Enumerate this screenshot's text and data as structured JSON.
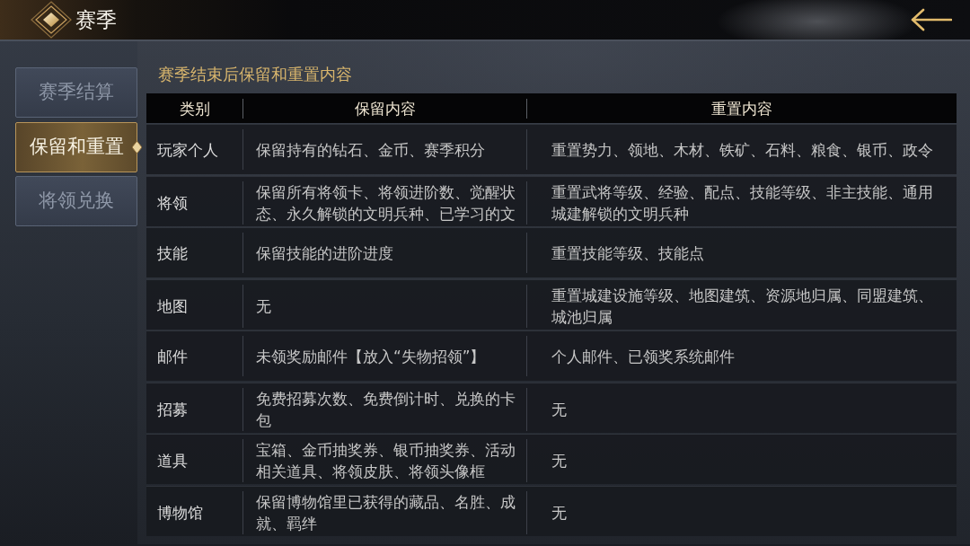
{
  "header": {
    "title": "赛季"
  },
  "sidebar": {
    "tabs": [
      {
        "label": "赛季结算",
        "selected": false
      },
      {
        "label": "保留和重置",
        "selected": true
      },
      {
        "label": "将领兑换",
        "selected": false
      }
    ]
  },
  "panel": {
    "title": "赛季结束后保留和重置内容",
    "table": {
      "columns": [
        "类别",
        "保留内容",
        "重置内容"
      ],
      "rows": [
        [
          "玩家个人",
          "保留持有的钻石、金币、赛季积分",
          "重置势力、领地、木材、铁矿、石料、粮食、银币、政令"
        ],
        [
          "将领",
          "保留所有将领卡、将领进阶数、觉醒状态、永久解锁的文明兵种、已学习的文",
          "重置武将等级、经验、配点、技能等级、非主技能、通用城建解锁的文明兵种"
        ],
        [
          "技能",
          "保留技能的进阶进度",
          "重置技能等级、技能点"
        ],
        [
          "地图",
          "无",
          "重置城建设施等级、地图建筑、资源地归属、同盟建筑、城池归属"
        ],
        [
          "邮件",
          "未领奖励邮件【放入“失物招领”】",
          "个人邮件、已领奖系统邮件"
        ],
        [
          "招募",
          "免费招募次数、免费倒计时、兑换的卡包",
          "无"
        ],
        [
          "道具",
          "宝箱、金币抽奖券、银币抽奖券、活动相关道具、将领皮肤、将领头像框",
          "无"
        ],
        [
          "博物馆",
          "保留博物馆里已获得的藏品、名胜、成就、羁绊",
          "无"
        ]
      ]
    }
  }
}
